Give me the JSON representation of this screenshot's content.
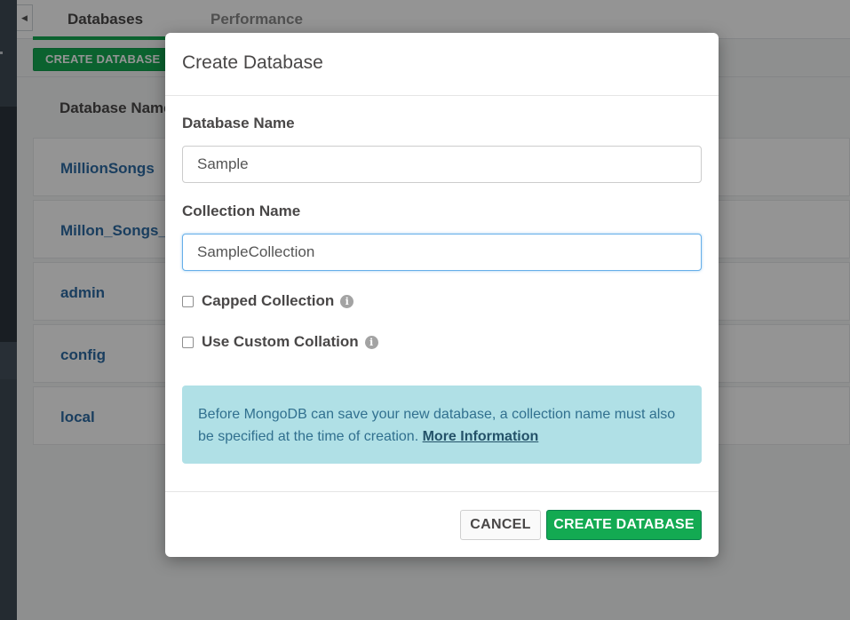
{
  "tabs": [
    {
      "label": "Databases",
      "active": true
    },
    {
      "label": "Performance",
      "active": false
    }
  ],
  "toolbar": {
    "create_database_label": "CREATE DATABASE"
  },
  "table": {
    "header": "Database Name",
    "rows": [
      {
        "name": "MillionSongs"
      },
      {
        "name": "Millon_Songs_Data"
      },
      {
        "name": "admin"
      },
      {
        "name": "config"
      },
      {
        "name": "local"
      }
    ]
  },
  "modal": {
    "title": "Create Database",
    "database_name_label": "Database Name",
    "database_name_value": "Sample",
    "collection_name_label": "Collection Name",
    "collection_name_value": "SampleCollection",
    "capped_collection_label": "Capped Collection",
    "custom_collation_label": "Use Custom Collation",
    "info_text": "Before MongoDB can save your new database, a collection name must also be specified at the time of creation.",
    "info_link": "More Information",
    "cancel_label": "CANCEL",
    "confirm_label": "CREATE DATABASE"
  },
  "colors": {
    "accent_green": "#13aa52",
    "link_blue": "#2e6ca4",
    "info_bg": "#b0e0e6",
    "info_text": "#31708f"
  },
  "icons": {
    "collapse": "chevron-left-icon",
    "info": "info-icon"
  }
}
